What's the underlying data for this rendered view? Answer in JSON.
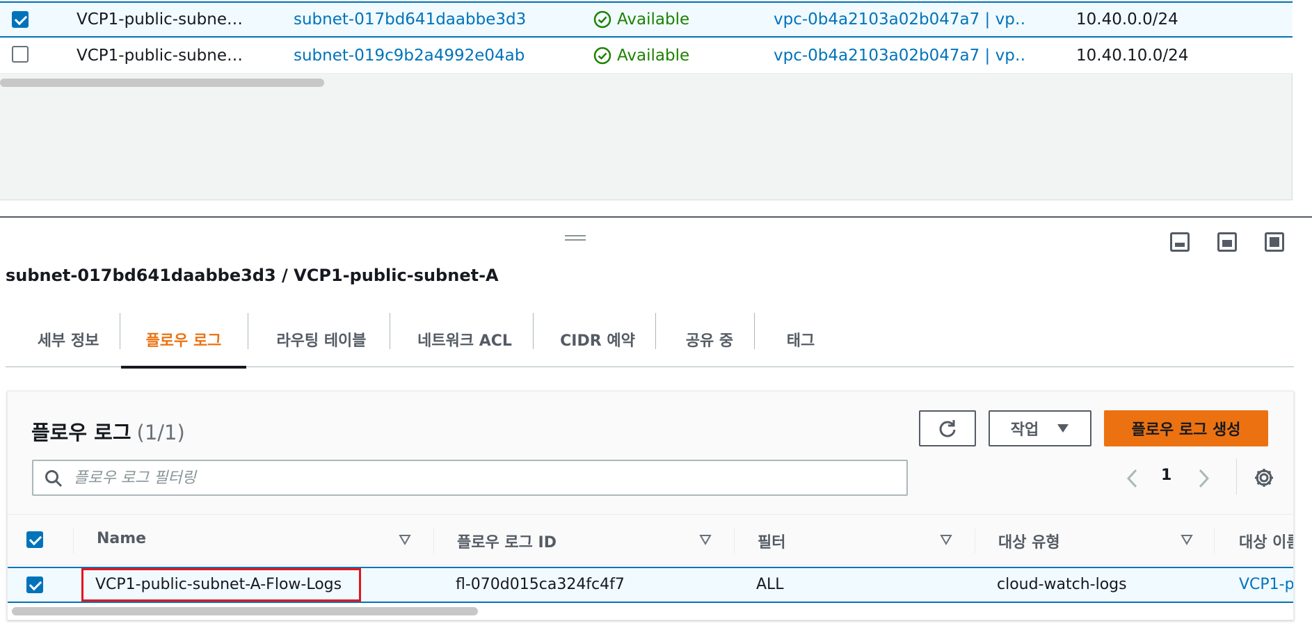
{
  "subnets": [
    {
      "selected": true,
      "name": "VCP1-public-subne…",
      "subnet_id": "subnet-017bd641daabbe3d3",
      "status": "Available",
      "vpc": "vpc-0b4a2103a02b047a7 | vp…",
      "cidr": "10.40.0.0/24"
    },
    {
      "selected": false,
      "name": "VCP1-public-subne…",
      "subnet_id": "subnet-019c9b2a4992e04ab",
      "status": "Available",
      "vpc": "vpc-0b4a2103a02b047a7 | vp…",
      "cidr": "10.40.10.0/24"
    }
  ],
  "detail": {
    "title": "subnet-017bd641daabbe3d3 / VCP1-public-subnet-A",
    "tabs": [
      {
        "label": "세부 정보",
        "active": false
      },
      {
        "label": "플로우 로그",
        "active": true
      },
      {
        "label": "라우팅 테이블",
        "active": false
      },
      {
        "label": "네트워크 ACL",
        "active": false
      },
      {
        "label": "CIDR 예약",
        "active": false
      },
      {
        "label": "공유 중",
        "active": false
      },
      {
        "label": "태그",
        "active": false
      }
    ]
  },
  "flow_logs": {
    "title": "플로우 로그",
    "count": "(1/1)",
    "actions_label": "작업",
    "create_label": "플로우 로그 생성",
    "search_placeholder": "플로우 로그 필터링",
    "page": "1",
    "columns": [
      "Name",
      "플로우 로그 ID",
      "필터",
      "대상 유형",
      "대상 이름"
    ],
    "rows": [
      {
        "selected": true,
        "name": "VCP1-public-subnet-A-Flow-Logs",
        "id": "fl-070d015ca324fc4f7",
        "filter": "ALL",
        "dest_type": "cloud-watch-logs",
        "dest_name": "VCP1-p"
      }
    ]
  },
  "colors": {
    "accent": "#ec7211",
    "link": "#0073bb",
    "success": "#1d8102",
    "highlight": "#e3161b"
  }
}
